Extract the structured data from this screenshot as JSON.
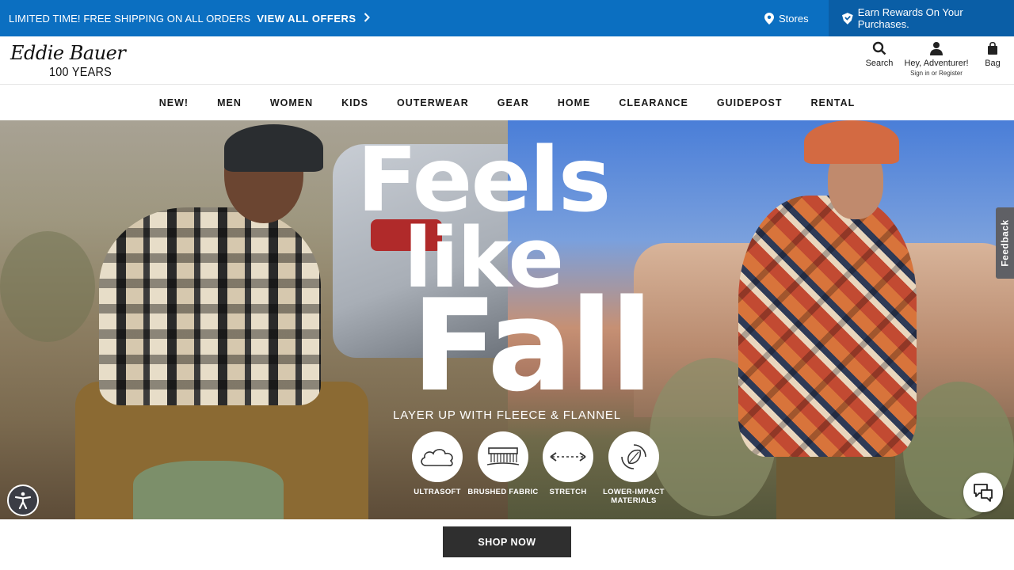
{
  "promo": {
    "text": "LIMITED TIME! FREE SHIPPING ON ALL ORDERS",
    "link": "VIEW ALL OFFERS",
    "stores": "Stores",
    "rewards": "Earn Rewards On Your Purchases."
  },
  "header": {
    "logo_script": "Eddie Bauer",
    "logo_years": "100 YEARS",
    "search_label": "Search",
    "account_label": "Hey, Adventurer!",
    "account_sub": "Sign in or Register",
    "bag_label": "Bag"
  },
  "nav": {
    "items": [
      "NEW!",
      "MEN",
      "WOMEN",
      "KIDS",
      "OUTERWEAR",
      "GEAR",
      "HOME",
      "CLEARANCE",
      "GUIDEPOST",
      "RENTAL"
    ]
  },
  "hero": {
    "line1": "Feels",
    "line2": "like",
    "line3": "Fall",
    "tagline": "LAYER UP WITH FLEECE & FLANNEL",
    "features": [
      {
        "label": "ULTRASOFT",
        "icon": "cloud-icon"
      },
      {
        "label": "BRUSHED FABRIC",
        "icon": "brush-icon"
      },
      {
        "label": "STRETCH",
        "icon": "stretch-arrows-icon"
      },
      {
        "label": "LOWER-IMPACT MATERIALS",
        "icon": "recycle-leaf-icon"
      }
    ],
    "cta": "SHOP NOW"
  },
  "widgets": {
    "feedback": "Feedback"
  },
  "colors": {
    "promo_bg": "#0b6fc1",
    "rewards_bg": "#0a5ea6",
    "cta_bg": "#2f2f2f"
  }
}
